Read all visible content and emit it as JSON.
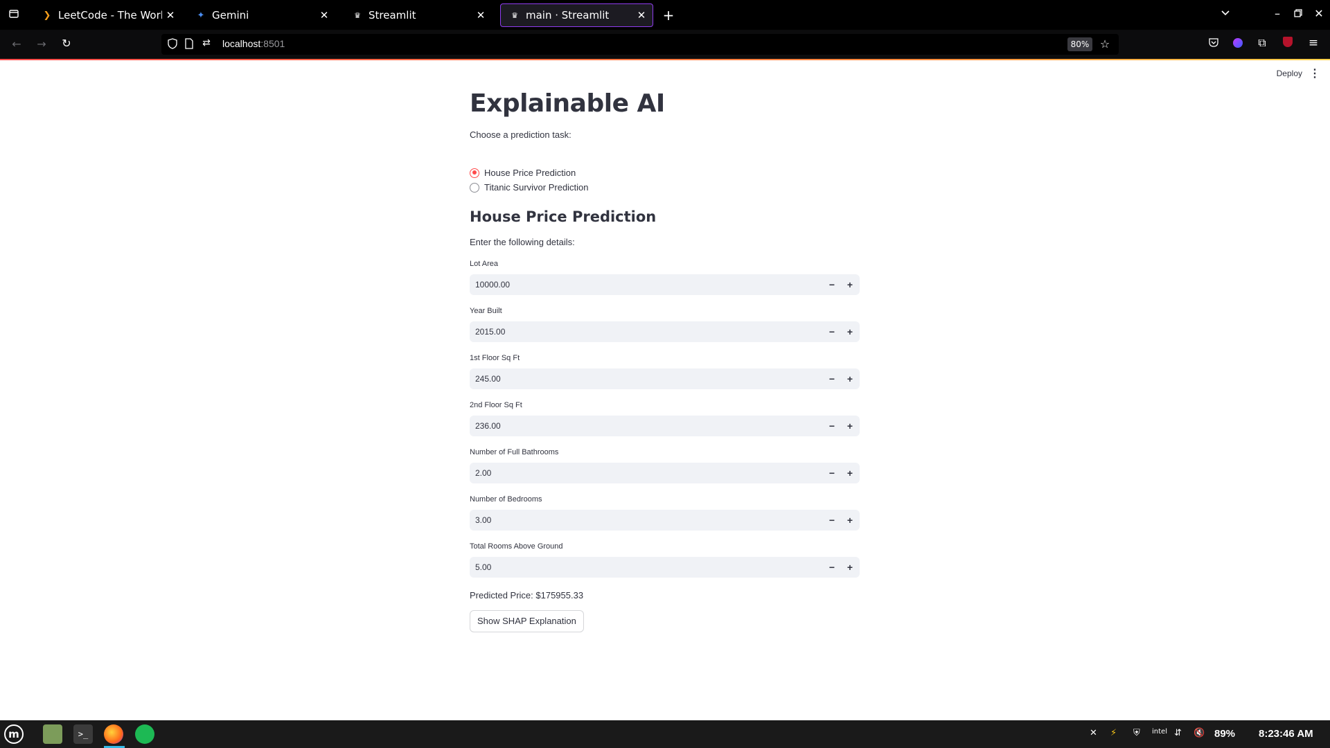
{
  "browser": {
    "tabs": [
      {
        "title": "LeetCode - The World's L",
        "favicon": "leetcode-icon",
        "active": false
      },
      {
        "title": "Gemini",
        "favicon": "gemini-icon",
        "active": false
      },
      {
        "title": "Streamlit",
        "favicon": "streamlit-icon",
        "active": false
      },
      {
        "title": "main · Streamlit",
        "favicon": "streamlit-icon",
        "active": true
      }
    ],
    "url_host": "localhost",
    "url_port": ":8501",
    "zoom": "80%"
  },
  "app": {
    "deploy_label": "Deploy",
    "title": "Explainable AI",
    "task_prompt": "Choose a prediction task:",
    "task_options": [
      {
        "label": "House Price Prediction",
        "selected": true
      },
      {
        "label": "Titanic Survivor Prediction",
        "selected": false
      }
    ],
    "section_title": "House Price Prediction",
    "details_prompt": "Enter the following details:",
    "fields": [
      {
        "label": "Lot Area",
        "value": "10000.00"
      },
      {
        "label": "Year Built",
        "value": "2015.00"
      },
      {
        "label": "1st Floor Sq Ft",
        "value": "245.00"
      },
      {
        "label": "2nd Floor Sq Ft",
        "value": "236.00"
      },
      {
        "label": "Number of Full Bathrooms",
        "value": "2.00"
      },
      {
        "label": "Number of Bedrooms",
        "value": "3.00"
      },
      {
        "label": "Total Rooms Above Ground",
        "value": "5.00"
      }
    ],
    "predicted_price": "Predicted Price: $175955.33",
    "shap_button": "Show SHAP Explanation",
    "accent_color": "#ff4b4b"
  },
  "taskbar": {
    "battery": "89%",
    "clock": "8:23:46 AM"
  }
}
